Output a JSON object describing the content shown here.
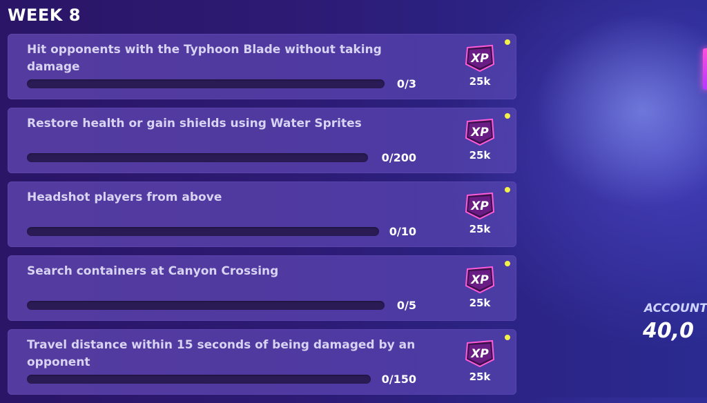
{
  "header": {
    "title": "WEEK 8"
  },
  "quests": [
    {
      "description": "Hit opponents with the Typhoon Blade without taking damage",
      "progress_text": "0/3",
      "progress_fraction": 0,
      "xp_label": "XP",
      "reward": "25k",
      "is_new": true
    },
    {
      "description": "Restore health or gain shields using Water Sprites",
      "progress_text": "0/200",
      "progress_fraction": 0,
      "xp_label": "XP",
      "reward": "25k",
      "is_new": true
    },
    {
      "description": "Headshot players from above",
      "progress_text": "0/10",
      "progress_fraction": 0,
      "xp_label": "XP",
      "reward": "25k",
      "is_new": true
    },
    {
      "description": "Search containers at Canyon Crossing",
      "progress_text": "0/5",
      "progress_fraction": 0,
      "xp_label": "XP",
      "reward": "25k",
      "is_new": true
    },
    {
      "description": "Travel distance within 15 seconds of being damaged by an opponent",
      "progress_text": "0/150",
      "progress_fraction": 0,
      "xp_label": "XP",
      "reward": "25k",
      "is_new": true
    }
  ],
  "account": {
    "label": "ACCOUNT",
    "value": "40,0"
  },
  "colors": {
    "accent_dot": "#f4f04a",
    "xp_badge_fill": "#7a1f8f",
    "xp_badge_edge": "#ff5ad9"
  },
  "icons": {
    "xp_badge": "xp-badge-icon",
    "new_indicator": "new-dot-icon"
  }
}
